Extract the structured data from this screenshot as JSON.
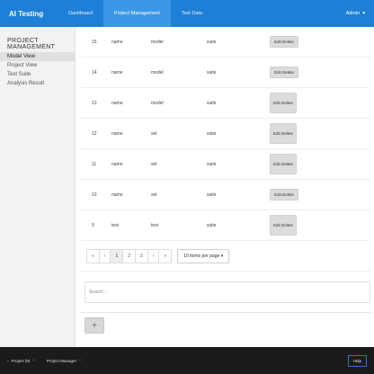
{
  "navbar": {
    "brand": "AI Testing",
    "items": [
      "Dashboard",
      "Project Management",
      "Test Data"
    ],
    "active_index": 1,
    "right_label": "Admin"
  },
  "sidebar": {
    "group": "PROJECT MANAGEMENT",
    "items": [
      "Model View",
      "Project View",
      "Test Suite",
      "Analysis Result"
    ],
    "active_index": 0
  },
  "main": {
    "search_placeholder": "Search...",
    "pager": {
      "pages": [
        "«",
        "‹",
        "1",
        "2",
        "3",
        "›",
        "»"
      ],
      "current_index": 2,
      "per_page_label": "10 items per page"
    },
    "rows": [
      {
        "id": "15",
        "a": "name",
        "b": "model",
        "c": "suite",
        "action": "Edit Delete",
        "tall": false
      },
      {
        "id": "14",
        "a": "name",
        "b": "model",
        "c": "suite",
        "action": "Edit Delete",
        "tall": false
      },
      {
        "id": "13",
        "a": "name",
        "b": "model",
        "c": "suite",
        "action": "Edit Delete",
        "tall": true
      },
      {
        "id": "12",
        "a": "name",
        "b": "set",
        "c": "suite",
        "action": "Edit Delete",
        "tall": true
      },
      {
        "id": "11",
        "a": "name",
        "b": "set",
        "c": "suite",
        "action": "Edit Delete",
        "tall": true
      },
      {
        "id": "10",
        "a": "name",
        "b": "set",
        "c": "suite",
        "action": "Edit Delete",
        "tall": false
      },
      {
        "id": "9",
        "a": "test",
        "b": "test",
        "c": "suite",
        "action": "Edit Delete",
        "tall": true
      }
    ]
  },
  "bottombar": {
    "tabs": [
      "Project list",
      "Project Manager"
    ],
    "right_button": "Help"
  },
  "colors": {
    "navbar": "#1e7fd6",
    "nav_active": "#3d97e8",
    "bottombar": "#1b1b1b"
  }
}
